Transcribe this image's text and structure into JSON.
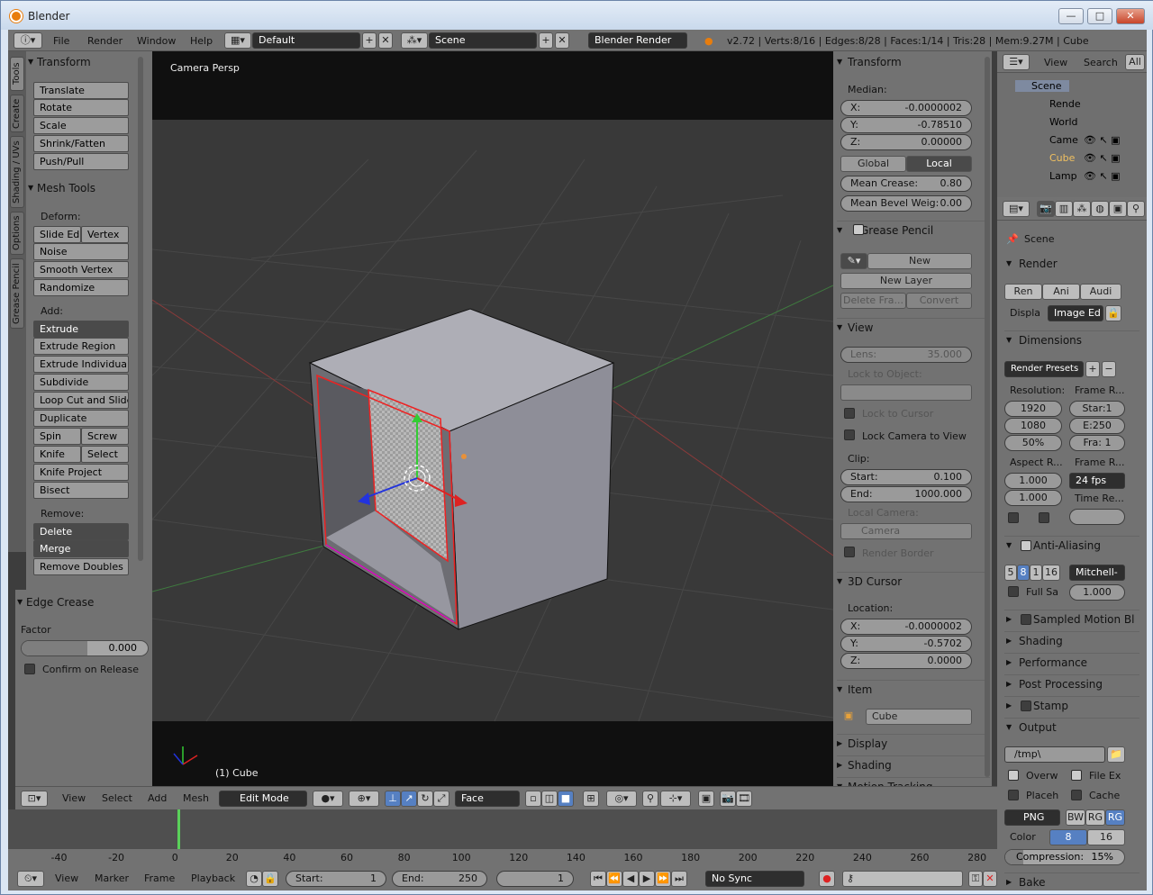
{
  "window": {
    "title": "Blender",
    "min": "—",
    "max": "□",
    "close": "✕"
  },
  "topbar": {
    "menus": [
      "File",
      "Render",
      "Window",
      "Help"
    ],
    "layout": "Default",
    "scene": "Scene",
    "engine": "Blender Render",
    "stats": "v2.72 | Verts:8/16 | Edges:8/28 | Faces:1/14 | Tris:28 | Mem:9.27M | Cube"
  },
  "tabs": [
    "Tools",
    "Create",
    "Shading / UVs",
    "Options",
    "Grease Pencil"
  ],
  "tools": {
    "transform_title": "Transform",
    "transform": [
      "Translate",
      "Rotate",
      "Scale",
      "Shrink/Fatten",
      "Push/Pull"
    ],
    "mesh_tools_title": "Mesh Tools",
    "deform_label": "Deform:",
    "slide_edge": "Slide Ed",
    "vertex": "Vertex",
    "deform": [
      "Noise",
      "Smooth Vertex",
      "Randomize"
    ],
    "add_label": "Add:",
    "extrude": "Extrude",
    "add": [
      "Extrude Region",
      "Extrude Individual",
      "Subdivide",
      "Loop Cut and Slide",
      "Duplicate"
    ],
    "spin": "Spin",
    "screw": "Screw",
    "knife": "Knife",
    "select": "Select",
    "add2": [
      "Knife Project",
      "Bisect"
    ],
    "remove_label": "Remove:",
    "delete": "Delete",
    "merge": "Merge",
    "remove_doubles": "Remove Doubles"
  },
  "edge_crease": {
    "title": "Edge Crease",
    "factor_label": "Factor",
    "factor": "0.000",
    "confirm": "Confirm on Release"
  },
  "viewport": {
    "label": "Camera Persp",
    "object_label": "(1) Cube"
  },
  "npanel": {
    "transform": "Transform",
    "median": "Median:",
    "x": "X:",
    "x_val": "-0.0000002",
    "y": "Y:",
    "y_val": "-0.78510",
    "z": "Z:",
    "z_val": "0.00000",
    "global": "Global",
    "local": "Local",
    "mean_crease": "Mean Crease:",
    "mean_crease_val": "0.80",
    "mean_bevel": "Mean Bevel Weig:",
    "mean_bevel_val": "0.00",
    "grease_pencil": "Grease Pencil",
    "new": "New",
    "new_layer": "New Layer",
    "delete_frame": "Delete Fra...",
    "convert": "Convert",
    "view": "View",
    "lens": "Lens:",
    "lens_val": "35.000",
    "lock_to_object": "Lock to Object:",
    "lock_to_cursor": "Lock to Cursor",
    "lock_camera": "Lock Camera to View",
    "clip": "Clip:",
    "start": "Start:",
    "start_val": "0.100",
    "end": "End:",
    "end_val": "1000.000",
    "local_camera": "Local Camera:",
    "camera": "Camera",
    "render_border": "Render Border",
    "cursor3d": "3D Cursor",
    "location": "Location:",
    "cx": "X:",
    "cx_val": "-0.0000002",
    "cy": "Y:",
    "cy_val": "-0.5702",
    "cz": "Z:",
    "cz_val": "0.0000",
    "item": "Item",
    "item_name": "Cube",
    "display": "Display",
    "shading": "Shading",
    "motion_tracking": "Motion Tracking"
  },
  "outliner": {
    "view": "View",
    "search": "Search",
    "all": "All",
    "items": [
      "Scene",
      "Rende",
      "World",
      "Came",
      "Cube",
      "Lamp"
    ]
  },
  "properties": {
    "scene": "Scene",
    "render": "Render",
    "ren": "Ren",
    "ani": "Ani",
    "audi": "Audi",
    "display": "Displa",
    "image_editor": "Image Ed",
    "dimensions": "Dimensions",
    "render_presets": "Render Presets",
    "resolution": "Resolution:",
    "frame_range": "Frame R...",
    "res_x": "1920",
    "res_y": "1080",
    "res_pct": "50%",
    "start_f": "Star:1",
    "end_f": "E:250",
    "frame_step": "Fra: 1",
    "aspect": "Aspect R...",
    "frame_rate": "Frame R...",
    "asp_x": "1.000",
    "asp_y": "1.000",
    "fps": "24 fps",
    "time_remap": "Time Re...",
    "anti_aliasing": "Anti-Aliasing",
    "aa_samples": [
      "5",
      "8",
      "1",
      "16"
    ],
    "filter": "Mitchell-",
    "full_sample": "Full Sa",
    "filter_size": "1.000",
    "sampled_motion": "Sampled Motion Bl",
    "shading": "Shading",
    "performance": "Performance",
    "post_processing": "Post Processing",
    "stamp": "Stamp",
    "output": "Output",
    "path": "/tmp\\",
    "overwrite": "Overw",
    "file_ext": "File Ex",
    "placeholders": "Placeh",
    "cache": "Cache",
    "format": "PNG",
    "bw": "BW",
    "rgb": "RG",
    "rgba": "RG",
    "color": "Color",
    "depth8": "8",
    "depth16": "16",
    "compression": "Compression:",
    "compression_val": "15%",
    "bake": "Bake"
  },
  "vpbar": {
    "view": "View",
    "select": "Select",
    "add": "Add",
    "mesh": "Mesh",
    "mode": "Edit Mode",
    "orient": "Face"
  },
  "timeline": {
    "ticks": [
      "-40",
      "-20",
      "0",
      "20",
      "40",
      "60",
      "80",
      "100",
      "120",
      "140",
      "160",
      "180",
      "200",
      "220",
      "240",
      "260",
      "280"
    ],
    "current_frame": 1
  },
  "tlbar": {
    "view": "View",
    "marker": "Marker",
    "frame": "Frame",
    "playback": "Playback",
    "start": "Start:",
    "start_val": "1",
    "end": "End:",
    "end_val": "250",
    "current": "1",
    "sync": "No Sync"
  }
}
